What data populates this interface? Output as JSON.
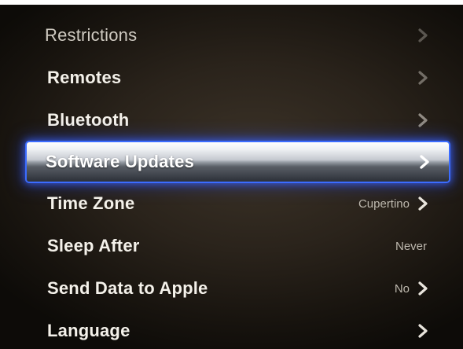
{
  "settings_menu": {
    "items": [
      {
        "label": "Restrictions",
        "value": "",
        "chevron": true
      },
      {
        "label": "Remotes",
        "value": "",
        "chevron": true
      },
      {
        "label": "Bluetooth",
        "value": "",
        "chevron": true
      },
      {
        "label": "Software Updates",
        "value": "",
        "chevron": true,
        "selected": true
      },
      {
        "label": "Time Zone",
        "value": "Cupertino",
        "chevron": true
      },
      {
        "label": "Sleep After",
        "value": "Never",
        "chevron": false
      },
      {
        "label": "Send Data to Apple",
        "value": "No",
        "chevron": true
      },
      {
        "label": "Language",
        "value": "",
        "chevron": true
      }
    ]
  },
  "icons": {
    "chevron": "chevron-right-icon"
  },
  "colors": {
    "selection_glow": "#3b6cff",
    "background": "#2a231b",
    "text": "#f4f1ea"
  }
}
